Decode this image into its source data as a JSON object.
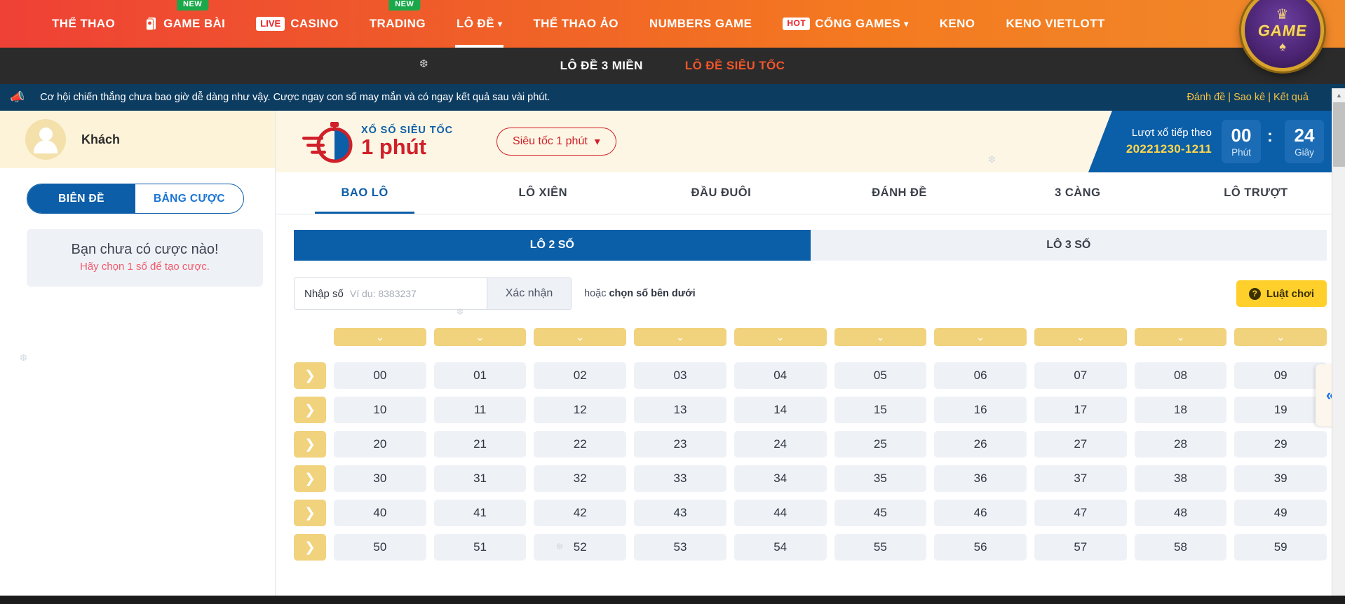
{
  "topnav": {
    "items": [
      {
        "label": "THỂ THAO",
        "badge": null,
        "icon": null,
        "caret": false,
        "underlined": false
      },
      {
        "label": "GAME BÀI",
        "badge": "NEW",
        "icon": "cards-icon",
        "caret": false,
        "underlined": false
      },
      {
        "label": "CASINO",
        "badge": null,
        "icon": "live-tag",
        "tag": "LIVE",
        "caret": false,
        "underlined": false
      },
      {
        "label": "TRADING",
        "badge": "NEW",
        "icon": null,
        "caret": false,
        "underlined": false
      },
      {
        "label": "LÔ ĐỀ",
        "badge": null,
        "icon": null,
        "caret": true,
        "underlined": true
      },
      {
        "label": "THỂ THAO ẢO",
        "badge": null,
        "icon": null,
        "caret": false,
        "underlined": false
      },
      {
        "label": "NUMBERS GAME",
        "badge": null,
        "icon": null,
        "caret": false,
        "underlined": false
      },
      {
        "label": "CỔNG GAMES",
        "badge": null,
        "icon": "hot-tag",
        "tag": "HOT",
        "caret": true,
        "underlined": false
      },
      {
        "label": "KENO",
        "badge": null,
        "icon": null,
        "caret": false,
        "underlined": false
      },
      {
        "label": "KENO VIETLOTT",
        "badge": null,
        "icon": null,
        "caret": false,
        "underlined": false
      }
    ],
    "logo": {
      "crown": "♛",
      "text": "GAME",
      "spade": "♠"
    }
  },
  "subnav": {
    "items": [
      {
        "label": "LÔ ĐỀ 3 MIỀN",
        "active": false
      },
      {
        "label": "LÔ ĐỀ SIÊU TỐC",
        "active": true
      }
    ]
  },
  "announce": {
    "icon": "megaphone-icon",
    "text": "Cơ hội chiến thắng chưa bao giờ dễ dàng như vậy. Cược ngay con số may mắn và có ngay kết quả sau vài phút.",
    "links": [
      "Đánh đề",
      "Sao kê",
      "Kết quả"
    ],
    "separator": "|"
  },
  "sidebar": {
    "user": {
      "name": "Khách",
      "avatar_icon": "user-avatar-icon"
    },
    "toggle": [
      {
        "label": "BIÊN ĐỀ",
        "active": true
      },
      {
        "label": "BẢNG CƯỢC",
        "active": false
      }
    ],
    "empty": {
      "title": "Bạn chưa có cược nào!",
      "subtitle": "Hãy chọn 1 số để tạo cược."
    }
  },
  "lottery": {
    "title_small": "XỔ SỐ SIÊU TỐC",
    "title_big": "1 phút",
    "stopwatch_icon": "stopwatch-icon",
    "speed_select": {
      "label": "Siêu tốc 1 phút",
      "caret_icon": "caret-down-icon"
    },
    "countdown": {
      "label": "Lượt xổ tiếp theo",
      "draw_id": "20221230-1211",
      "minutes": "00",
      "minutes_unit": "Phút",
      "seconds": "24",
      "seconds_unit": "Giây",
      "colon": ":"
    },
    "tabs": [
      {
        "label": "BAO LÔ",
        "active": true
      },
      {
        "label": "LÔ XIÊN",
        "active": false
      },
      {
        "label": "ĐẦU ĐUÔI",
        "active": false
      },
      {
        "label": "ĐÁNH ĐỀ",
        "active": false
      },
      {
        "label": "3 CÀNG",
        "active": false
      },
      {
        "label": "LÔ TRƯỢT",
        "active": false
      }
    ],
    "subtabs": [
      {
        "label": "LÔ 2 SỐ",
        "active": true
      },
      {
        "label": "LÔ 3 SỐ",
        "active": false
      }
    ],
    "input": {
      "label": "Nhập số",
      "placeholder": "Ví dụ: 8383237",
      "value": "",
      "confirm_label": "Xác nhận",
      "or_prefix": "hoặc ",
      "or_strong": "chọn số bên dưới"
    },
    "rule_button": {
      "label": "Luật chơi",
      "icon": "question-icon"
    },
    "grid": {
      "column_header_icon": "chevron-down-icon",
      "row_button_icon": "chevron-right-icon",
      "columns": 10,
      "rows": [
        [
          "00",
          "01",
          "02",
          "03",
          "04",
          "05",
          "06",
          "07",
          "08",
          "09"
        ],
        [
          "10",
          "11",
          "12",
          "13",
          "14",
          "15",
          "16",
          "17",
          "18",
          "19"
        ],
        [
          "20",
          "21",
          "22",
          "23",
          "24",
          "25",
          "26",
          "27",
          "28",
          "29"
        ],
        [
          "30",
          "31",
          "32",
          "33",
          "34",
          "35",
          "36",
          "37",
          "38",
          "39"
        ],
        [
          "40",
          "41",
          "42",
          "43",
          "44",
          "45",
          "46",
          "47",
          "48",
          "49"
        ],
        [
          "50",
          "51",
          "52",
          "53",
          "54",
          "55",
          "56",
          "57",
          "58",
          "59"
        ]
      ]
    },
    "collapse_handle": {
      "icon": "double-chevron-left-icon",
      "glyph": "«"
    }
  },
  "colors": {
    "nav_start": "#ef4136",
    "nav_end": "#f0892a",
    "announce_bg": "#0d3c61",
    "accent_blue": "#0b5ea8",
    "accent_red": "#d0202a",
    "accent_yellow": "#f1d27d",
    "rule_yellow": "#ffd02b"
  },
  "decorations": {
    "snowflake": "❆"
  }
}
